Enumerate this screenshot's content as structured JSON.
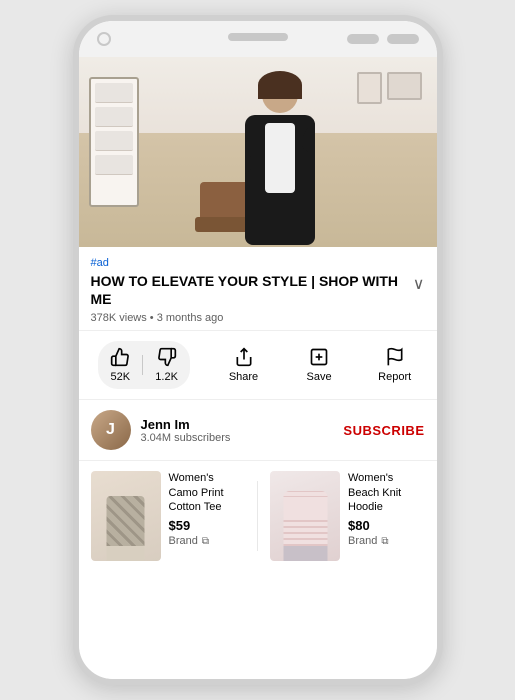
{
  "phone": {
    "top_circle": "",
    "speaker": "",
    "btn1": "",
    "btn2": ""
  },
  "video": {
    "ad_tag": "#ad",
    "title": "HOW TO ELEVATE YOUR STYLE | SHOP WITH ME",
    "views": "378K views",
    "time_ago": "3 months ago",
    "meta": "378K views • 3 months ago",
    "chevron": "∨"
  },
  "actions": {
    "like_count": "52K",
    "dislike_count": "1.2K",
    "share_label": "Share",
    "save_label": "Save",
    "report_label": "Report"
  },
  "channel": {
    "name": "Jenn Im",
    "subscribers": "3.04M subscribers",
    "initial": "J",
    "subscribe_label": "SUBSCRIBE"
  },
  "products": [
    {
      "name": "Women's Camo Print Cotton Tee",
      "price": "$59",
      "brand": "Brand",
      "link_icon": "⧉"
    },
    {
      "name": "Women's Beach Knit Hoodie",
      "price": "$80",
      "brand": "Brand",
      "link_icon": "⧉"
    }
  ]
}
